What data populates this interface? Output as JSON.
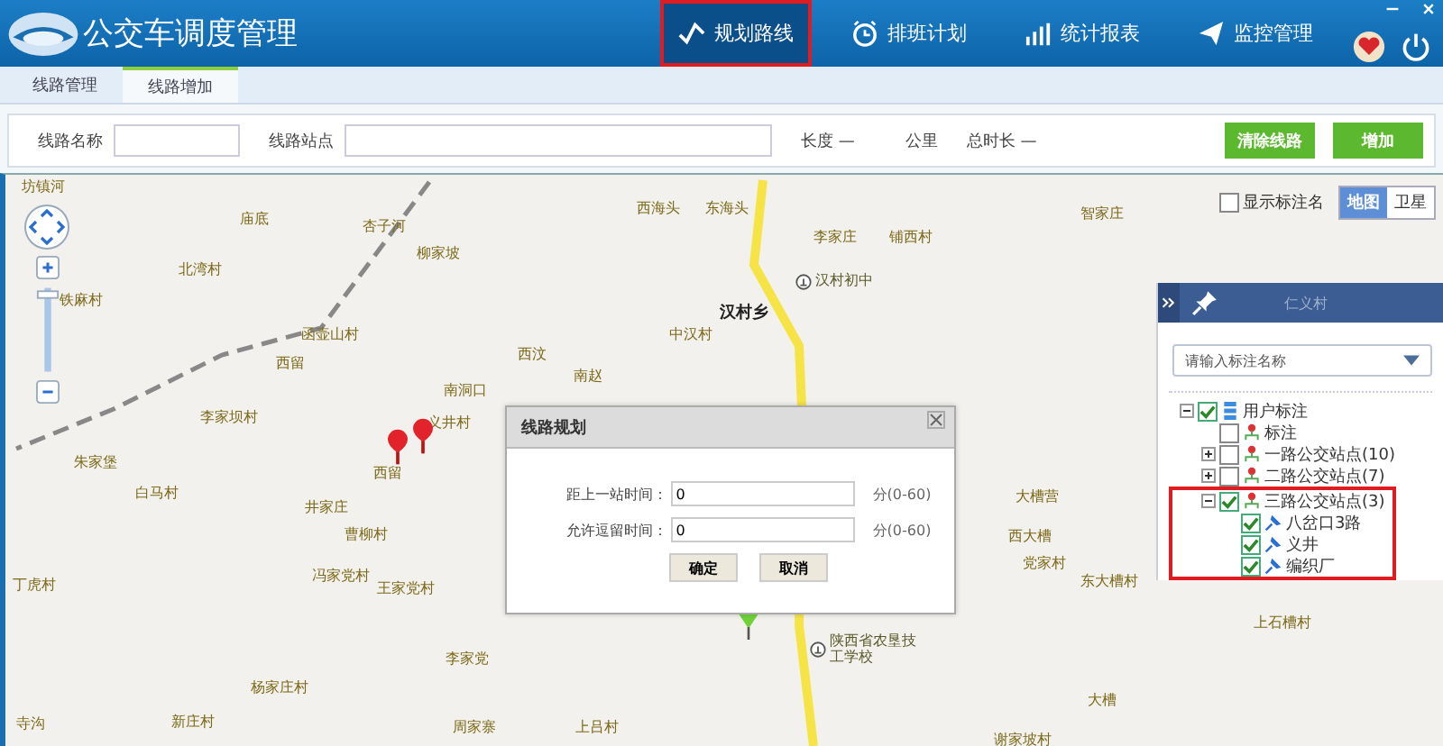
{
  "header": {
    "title": "公交车调度管理",
    "nav": [
      {
        "label": "规划路线",
        "selected": true,
        "kind": "route"
      },
      {
        "label": "排班计划",
        "selected": false,
        "kind": "clock"
      },
      {
        "label": "统计报表",
        "selected": false,
        "kind": "chart"
      },
      {
        "label": "监控管理",
        "selected": false,
        "kind": "send"
      }
    ]
  },
  "tabs": [
    {
      "label": "线路管理",
      "selected": false
    },
    {
      "label": "线路增加",
      "selected": true
    }
  ],
  "toolbar": {
    "name_label": "线路名称",
    "stops_label": "线路站点",
    "length_label": "长度 —",
    "unit": "公里",
    "duration_label": "总时长 —",
    "buttons": [
      "清除线路",
      "增加"
    ]
  },
  "map": {
    "show_names": {
      "label": "显示标注名",
      "checked": false
    },
    "map_types": [
      {
        "label": "地图",
        "selected": true
      },
      {
        "label": "卫星",
        "selected": false
      }
    ],
    "labels": [
      {
        "text": "坊镇河",
        "kind": "place"
      },
      {
        "text": "庙底",
        "kind": "place"
      },
      {
        "text": "杏子河",
        "kind": "place"
      },
      {
        "text": "柳家坡",
        "kind": "place"
      },
      {
        "text": "北湾村",
        "kind": "place"
      },
      {
        "text": "铁麻村",
        "kind": "place"
      },
      {
        "text": "函壶山村",
        "kind": "place"
      },
      {
        "text": "西留",
        "kind": "place"
      },
      {
        "text": "南洞口",
        "kind": "place"
      },
      {
        "text": "西汶",
        "kind": "place"
      },
      {
        "text": "南赵",
        "kind": "place"
      },
      {
        "text": "中汉村",
        "kind": "place"
      },
      {
        "text": "汉村乡",
        "kind": "town"
      },
      {
        "text": "李家坝村",
        "kind": "place"
      },
      {
        "text": "义井村",
        "kind": "place"
      },
      {
        "text": "朱家堡",
        "kind": "place"
      },
      {
        "text": "西留",
        "kind": "place"
      },
      {
        "text": "白马村",
        "kind": "place"
      },
      {
        "text": "井家庄",
        "kind": "place"
      },
      {
        "text": "曹柳村",
        "kind": "place"
      },
      {
        "text": "冯家党村",
        "kind": "place"
      },
      {
        "text": "王家党村",
        "kind": "place"
      },
      {
        "text": "丁虎村",
        "kind": "place"
      },
      {
        "text": "李家党",
        "kind": "place"
      },
      {
        "text": "杨家庄村",
        "kind": "place"
      },
      {
        "text": "寺沟",
        "kind": "place"
      },
      {
        "text": "新庄村",
        "kind": "place"
      },
      {
        "text": "周家寨",
        "kind": "place"
      },
      {
        "text": "上吕村",
        "kind": "place"
      },
      {
        "text": "西海头",
        "kind": "place"
      },
      {
        "text": "东海头",
        "kind": "place"
      },
      {
        "text": "李家庄",
        "kind": "place"
      },
      {
        "text": "铺西村",
        "kind": "place"
      },
      {
        "text": "智家庄",
        "kind": "place"
      },
      {
        "text": "汉村初中",
        "kind": "school"
      },
      {
        "text": "大槽营",
        "kind": "place"
      },
      {
        "text": "西大槽",
        "kind": "place"
      },
      {
        "text": "党家村",
        "kind": "place"
      },
      {
        "text": "东大槽村",
        "kind": "place"
      },
      {
        "text": "陕西省农垦技工学校",
        "kind": "school"
      },
      {
        "text": "大槽",
        "kind": "place"
      },
      {
        "text": "谢家坡村",
        "kind": "place"
      },
      {
        "text": "上石槽村",
        "kind": "place"
      }
    ]
  },
  "panel": {
    "faded_label": "仁义村",
    "search_placeholder": "请输入标注名称",
    "tree": [
      {
        "label": "用户标注",
        "checked": true,
        "expanded": true,
        "highlighted": false,
        "kind": "root",
        "children": [
          {
            "label": "标注",
            "checked": false,
            "highlighted": false,
            "kind": "group"
          },
          {
            "label": "一路公交站点(10)",
            "checked": false,
            "expanded": false,
            "highlighted": false,
            "kind": "group"
          },
          {
            "label": "二路公交站点(7)",
            "checked": false,
            "expanded": false,
            "highlighted": false,
            "kind": "group"
          },
          {
            "label": "三路公交站点(3)",
            "checked": true,
            "expanded": true,
            "highlighted": true,
            "kind": "group",
            "children": [
              {
                "label": "八岔口3路",
                "checked": true,
                "kind": "pin"
              },
              {
                "label": "义井",
                "checked": true,
                "kind": "pin"
              },
              {
                "label": "编织厂",
                "checked": true,
                "kind": "pin"
              }
            ]
          }
        ]
      }
    ]
  },
  "dialog": {
    "title": "线路规划",
    "fields": [
      {
        "label": "距上一站时间：",
        "value": "0",
        "hint": "分(0-60)"
      },
      {
        "label": "允许逗留时间：",
        "value": "0",
        "hint": "分(0-60)"
      }
    ],
    "buttons": [
      "确定",
      "取消"
    ]
  }
}
